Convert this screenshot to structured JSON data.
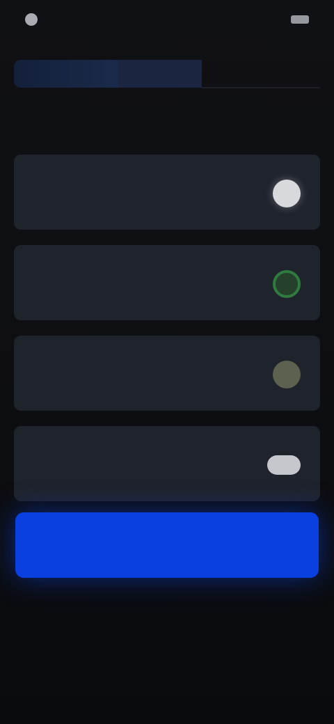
{
  "status_bar": {
    "time": "",
    "right_text": ""
  },
  "header": {
    "active_tab": ""
  },
  "title": "",
  "options": [
    {
      "title": "",
      "subtitle": "",
      "toggle_style": "on-white"
    },
    {
      "title": "",
      "subtitle": "",
      "toggle_style": "on-green"
    },
    {
      "title": "",
      "subtitle": "",
      "toggle_style": "on-olive"
    },
    {
      "title": "",
      "subtitle": "",
      "toggle_style": "pill"
    }
  ],
  "primary_button": {
    "label": ""
  },
  "colors": {
    "background": "#0b0c0f",
    "card": "#1f232c",
    "accent_blue": "#0a3fe0",
    "toggle_green": "#2f7b3e"
  }
}
